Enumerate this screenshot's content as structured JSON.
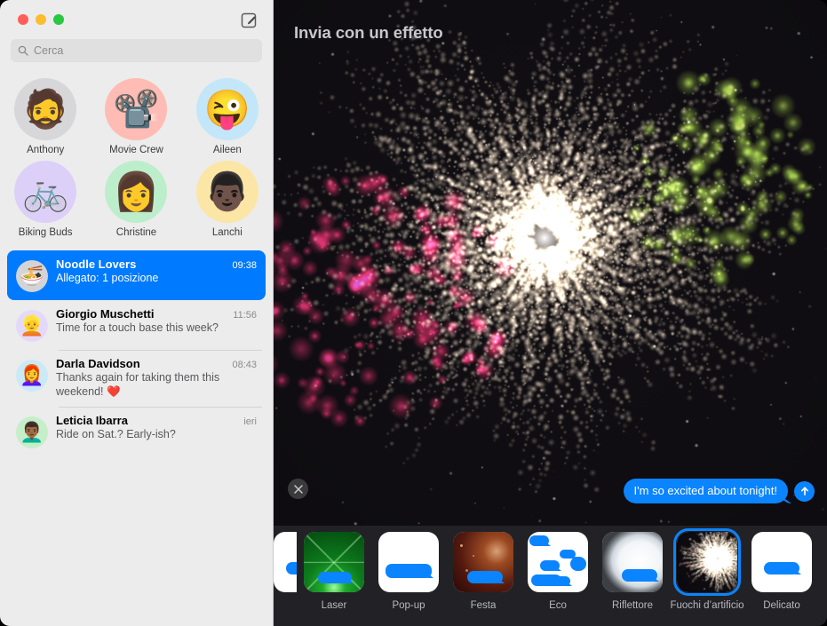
{
  "window": {
    "traffic_lights": [
      "close",
      "minimize",
      "zoom"
    ],
    "compose_icon": "compose-pencil-icon"
  },
  "sidebar": {
    "search": {
      "placeholder": "Cerca",
      "icon": "search-icon"
    },
    "pinned": [
      {
        "name": "Anthony",
        "glyph": "🧔",
        "bg": "#d7d7d9"
      },
      {
        "name": "Movie Crew",
        "glyph": "📽️",
        "bg": "#febcb4"
      },
      {
        "name": "Aileen",
        "glyph": "😜",
        "bg": "#c3e7f8"
      },
      {
        "name": "Biking Buds",
        "glyph": "🚲",
        "bg": "#ddd0f8"
      },
      {
        "name": "Christine",
        "glyph": "👩",
        "bg": "#bdeecb"
      },
      {
        "name": "Lanchi",
        "glyph": "👨🏿",
        "bg": "#fbe6a6"
      }
    ],
    "conversations": [
      {
        "name": "Noodle Lovers",
        "time": "09:38",
        "preview": "Allegato:  1 posizione",
        "glyph": "🍜",
        "bg": "#d4d4d6",
        "selected": true
      },
      {
        "name": "Giorgio Muschetti",
        "time": "11:56",
        "preview": "Time for a touch base this week?",
        "glyph": "👱",
        "bg": "#e5d9fb",
        "selected": false
      },
      {
        "name": "Darla Davidson",
        "time": "08:43",
        "preview": "Thanks again for taking them this weekend! ❤️",
        "glyph": "👩‍🦰",
        "bg": "#cbeaf8",
        "selected": false
      },
      {
        "name": "Leticia Ibarra",
        "time": "ieri",
        "preview": "Ride on Sat.? Early-ish?",
        "glyph": "👨🏾‍🦱",
        "bg": "#c6efc9",
        "selected": false
      }
    ]
  },
  "main": {
    "title": "Invia con un effetto",
    "close_icon": "close-x-icon",
    "message": "I'm so excited about tonight!",
    "send_icon": "send-arrow-up-icon",
    "effects": [
      {
        "label": "",
        "style": "partial",
        "selected": false
      },
      {
        "label": "Laser",
        "style": "laser",
        "selected": false
      },
      {
        "label": "Pop-up",
        "style": "popup",
        "selected": false
      },
      {
        "label": "Festa",
        "style": "festa",
        "selected": false
      },
      {
        "label": "Eco",
        "style": "eco",
        "selected": false
      },
      {
        "label": "Riflettore",
        "style": "riflettore",
        "selected": false
      },
      {
        "label": "Fuochi d’artificio",
        "style": "fireworks",
        "selected": true
      },
      {
        "label": "Delicato",
        "style": "delicato",
        "selected": false
      }
    ]
  },
  "colors": {
    "accent": "#007aff",
    "bubble": "#0b84ff",
    "sidebar_bg": "#ececec",
    "stage_bg": "#100e12",
    "strip_bg": "#222226",
    "firework_warm": "#fff3e0",
    "firework_pink": "#ff2d6f",
    "firework_green": "#b4e84a"
  }
}
